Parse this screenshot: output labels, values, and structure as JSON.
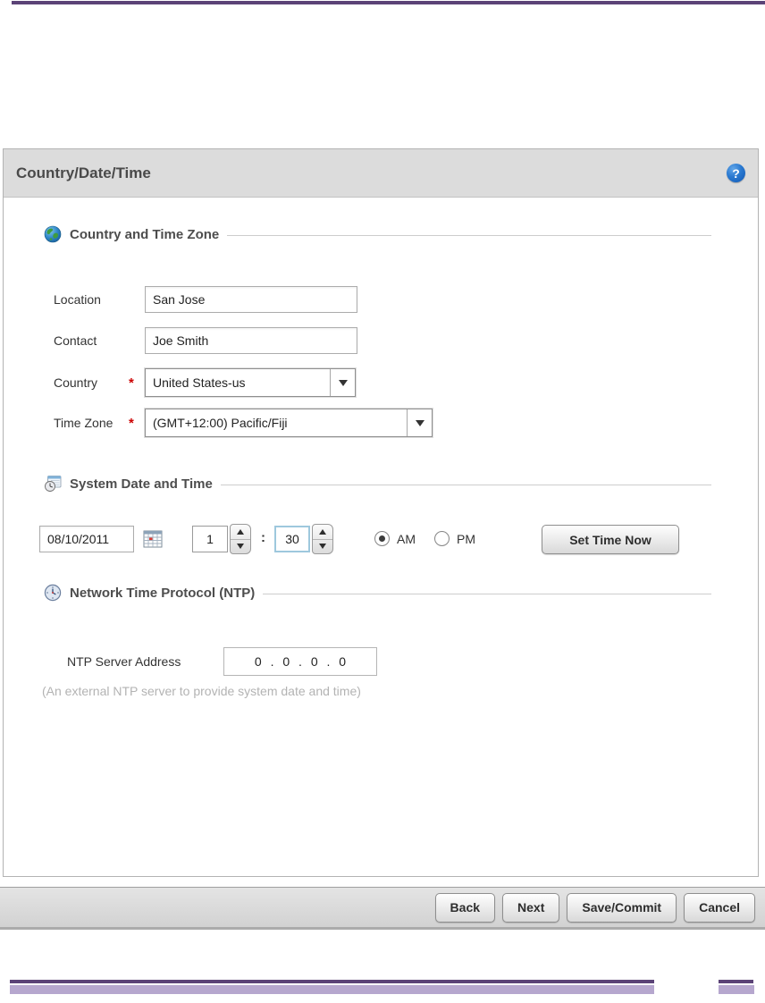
{
  "window": {
    "title": "Country/Date/Time",
    "help_glyph": "?"
  },
  "country_section": {
    "title": "Country and Time Zone",
    "location_label": "Location",
    "location_value": "San Jose",
    "contact_label": "Contact",
    "contact_value": "Joe Smith",
    "country_label": "Country",
    "country_required": "*",
    "country_value": "United States-us",
    "timezone_label": "Time Zone",
    "timezone_required": "*",
    "timezone_value": "(GMT+12:00) Pacific/Fiji"
  },
  "datetime_section": {
    "title": "System Date and Time",
    "date_value": "08/10/2011",
    "hour_value": "1",
    "time_separator": ":",
    "minute_value": "30",
    "am_label": "AM",
    "pm_label": "PM",
    "selected_meridiem": "AM",
    "set_time_button": "Set Time Now"
  },
  "ntp_section": {
    "title": "Network Time Protocol (NTP)",
    "server_label": "NTP Server Address",
    "server_value": "0 . 0 . 0 . 0",
    "hint": "(An external NTP server to provide system date and time)"
  },
  "footer": {
    "buttons": [
      "Back",
      "Next",
      "Save/Commit",
      "Cancel"
    ]
  },
  "colors": {
    "accent_purple_dark": "#5b4377",
    "accent_purple_light": "#b6a7ce",
    "header_gray": "#dcdcdc",
    "help_blue": "#1258b4",
    "required_red": "#cc0000",
    "focus_blue": "#9ec8dd"
  }
}
